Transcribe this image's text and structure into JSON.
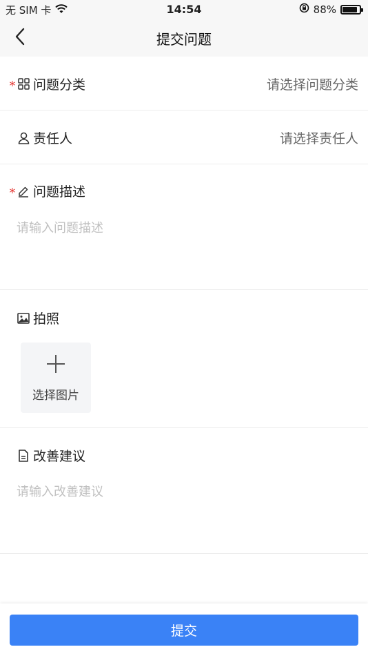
{
  "status_bar": {
    "carrier": "无 SIM 卡",
    "time": "14:54",
    "battery": "88%",
    "battery_level": 0.88
  },
  "nav": {
    "title": "提交问题",
    "back_icon": "chevron-left-icon"
  },
  "form": {
    "category": {
      "label": "问题分类",
      "required_mark": "*",
      "placeholder": "请选择问题分类",
      "icon": "grid-icon"
    },
    "assignee": {
      "label": "责任人",
      "placeholder": "请选择责任人",
      "icon": "user-icon"
    },
    "description": {
      "label": "问题描述",
      "required_mark": "*",
      "placeholder": "请输入问题描述",
      "icon": "edit-icon"
    },
    "photo": {
      "label": "拍照",
      "add_label": "选择图片",
      "icon": "image-icon"
    },
    "suggestion": {
      "label": "改善建议",
      "placeholder": "请输入改善建议",
      "icon": "document-icon"
    }
  },
  "actions": {
    "submit_label": "提交"
  },
  "colors": {
    "primary": "#3a82f6",
    "required": "#e53935",
    "header_bg": "#f7f7f7",
    "placeholder": "#c0c0c0"
  }
}
